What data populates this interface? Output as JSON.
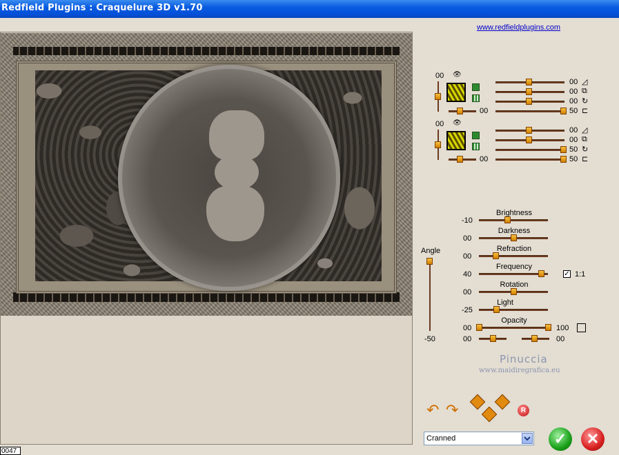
{
  "window": {
    "title": "Redfield Plugins : Craquelure 3D  v1.70"
  },
  "link": {
    "text": "www.redfieldplugins.com"
  },
  "layer1": {
    "top_value": "00",
    "slider_values": [
      "00",
      "00",
      "00",
      "50"
    ],
    "bottom_left_value": "00"
  },
  "layer2": {
    "top_value": "00",
    "slider_values": [
      "00",
      "00",
      "50",
      "50"
    ],
    "bottom_left_value": "00"
  },
  "angle": {
    "label": "Angle",
    "value": "-50"
  },
  "params": [
    {
      "label": "Brightness",
      "value": "-10"
    },
    {
      "label": "Darkness",
      "value": "00"
    },
    {
      "label": "Refraction",
      "value": "00"
    },
    {
      "label": "Frequency",
      "value": "40"
    },
    {
      "label": "Rotation",
      "value": "00"
    },
    {
      "label": "Light",
      "value": "-25"
    },
    {
      "label": "Opacity",
      "value": "00"
    }
  ],
  "opacity_max": "100",
  "ratio_checkbox": {
    "label": "1:1",
    "checked_mark": "✓"
  },
  "bottom_pair": {
    "left": "00",
    "right": "00"
  },
  "watermark": {
    "name": "Pinuccia",
    "site": "www.maidiregrafica.eu"
  },
  "preset": {
    "selected": "Cranned"
  },
  "reset_label": "R",
  "ok_glyph": "✓",
  "cancel_glyph": "✕",
  "counter": "0047"
}
